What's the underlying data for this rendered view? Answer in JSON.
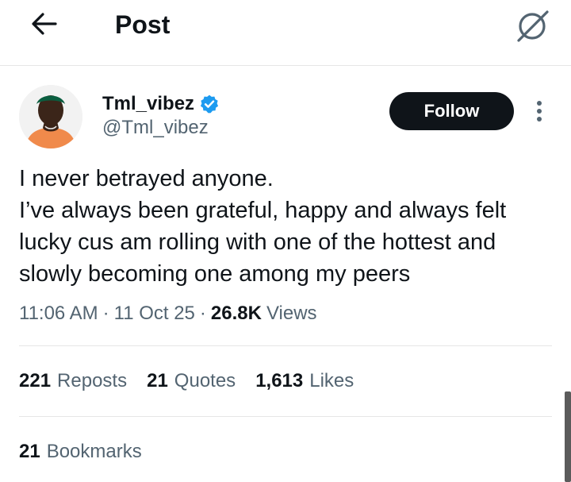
{
  "header": {
    "title": "Post",
    "back_icon": "arrow-left-icon",
    "grok_icon": "grok-icon"
  },
  "author": {
    "display_name": "Tml_vibez",
    "handle": "@Tml_vibez",
    "verified": true,
    "follow_label": "Follow",
    "more_icon": "more-vertical-icon"
  },
  "post": {
    "text": "I never betrayed anyone.\nI’ve always been grateful, happy and always felt lucky cus am rolling with one of the hottest and slowly  becoming one among my peers",
    "time": "11:06 AM",
    "date": "11 Oct 25",
    "views_count": "26.8K",
    "views_label": "Views"
  },
  "stats": {
    "reposts_count": "221",
    "reposts_label": "Reposts",
    "quotes_count": "21",
    "quotes_label": "Quotes",
    "likes_count": "1,613",
    "likes_label": "Likes",
    "bookmarks_count": "21",
    "bookmarks_label": "Bookmarks"
  },
  "colors": {
    "text_primary": "#0f1419",
    "text_secondary": "#536471",
    "verified_blue": "#1d9bf0",
    "follow_bg": "#0f1419",
    "divider": "#e6e6e6"
  }
}
